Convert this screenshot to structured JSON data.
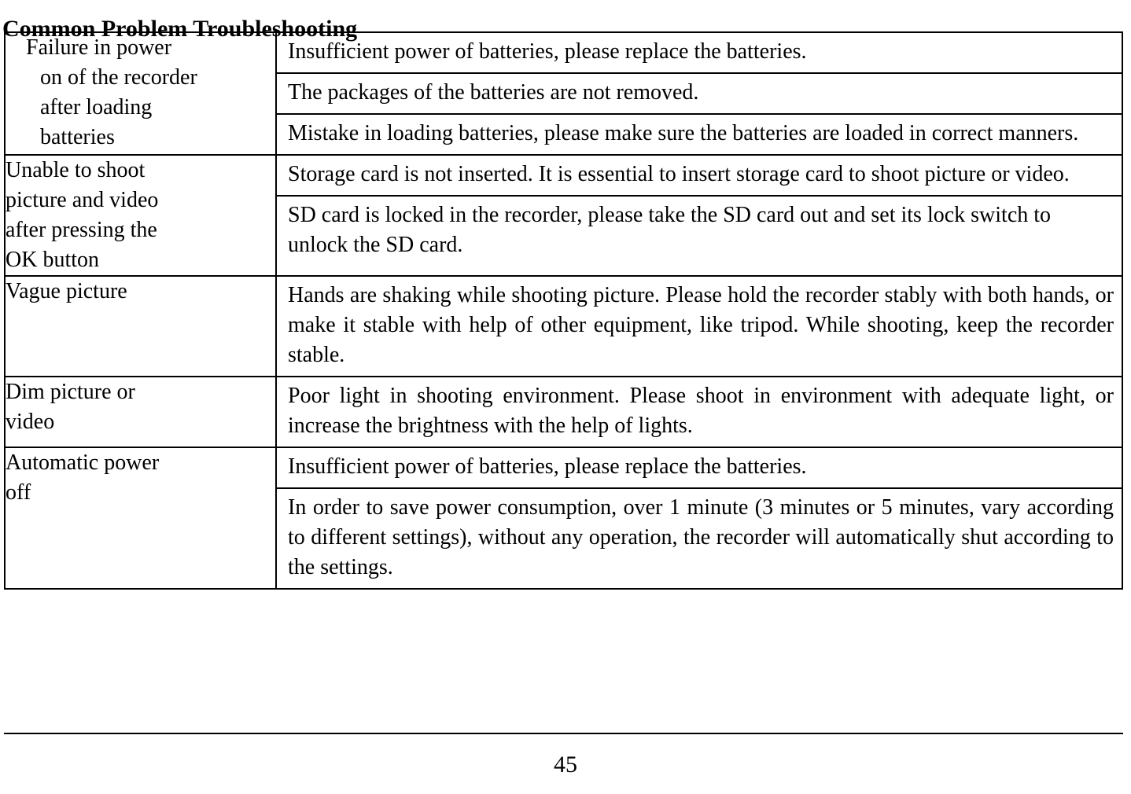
{
  "document": {
    "title": "Common Problem Troubleshooting",
    "page_number": "45"
  },
  "table": {
    "rows": [
      {
        "label_lines": {
          "line1": "Failure in power",
          "line2": "on of the recorder",
          "line3": "after loading",
          "line4": "batteries"
        },
        "label_plain": "Failure in power on of the recorder after loading batteries",
        "descriptions": [
          "Insufficient power of batteries, please replace the batteries.",
          "The packages of the batteries are not removed.",
          "Mistake in loading batteries, please make sure the batteries are loaded in correct manners."
        ]
      },
      {
        "label_lines": {
          "line1": "Unable to shoot",
          "line2": "picture and video",
          "line3": "after pressing the",
          "line4": "OK button"
        },
        "label_plain": "Unable to shoot picture and video after pressing the OK button",
        "descriptions": [
          "Storage card is not inserted. It is essential to insert storage card to shoot picture or video.",
          "SD card is locked in the recorder, please take the SD card out and set its lock switch to unlock the SD card."
        ]
      },
      {
        "label_lines": {
          "line1": "Vague picture",
          "line2": "",
          "line3": "",
          "line4": ""
        },
        "label_plain": "Vague picture",
        "descriptions": [
          "Hands are shaking while shooting picture. Please hold the recorder stably with both hands, or make it stable with help of other equipment, like tripod. While shooting, keep the recorder stable."
        ]
      },
      {
        "label_lines": {
          "line1": "Dim picture or",
          "line2": "video",
          "line3": "",
          "line4": ""
        },
        "label_plain": "Dim picture or video",
        "descriptions": [
          "Poor light in shooting environment. Please shoot in environment with adequate light, or increase the brightness with the help of lights."
        ]
      },
      {
        "label_lines": {
          "line1": "Automatic power",
          "line2": "off",
          "line3": "",
          "line4": ""
        },
        "label_plain": "Automatic power off",
        "descriptions": [
          "Insufficient power of batteries, please replace the batteries.",
          "In order to save power consumption, over 1 minute (3 minutes or 5 minutes, vary according to different settings), without any operation, the recorder will automatically shut according to the settings."
        ]
      }
    ]
  },
  "colors": {
    "text": "#000000",
    "background": "#ffffff",
    "rule": "#000000"
  }
}
